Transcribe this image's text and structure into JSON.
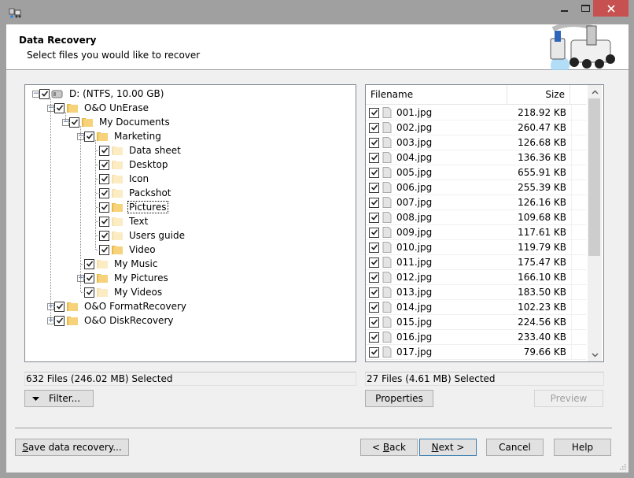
{
  "window": {
    "app_icon": "recovery-robot-icon",
    "controls": {
      "minimize": "minimize-icon",
      "maximize": "maximize-icon",
      "close": "close-icon"
    }
  },
  "header": {
    "title": "Data Recovery",
    "subtitle": "Select files you would like to recover",
    "art": "recovery-robot-illustration"
  },
  "tree": {
    "items": [
      {
        "label": "D: (NTFS, 10.00 GB)",
        "level": 0,
        "expander": "minus",
        "checked": true,
        "icon": "drive-icon"
      },
      {
        "label": "O&O UnErase",
        "level": 1,
        "expander": "minus",
        "checked": true,
        "icon": "folder-icon"
      },
      {
        "label": "My Documents",
        "level": 2,
        "expander": "minus",
        "checked": true,
        "icon": "folder-icon"
      },
      {
        "label": "Marketing",
        "level": 3,
        "expander": "minus",
        "checked": true,
        "icon": "folder-icon"
      },
      {
        "label": "Data sheet",
        "level": 4,
        "expander": "none",
        "checked": true,
        "icon": "folder-empty-icon"
      },
      {
        "label": "Desktop",
        "level": 4,
        "expander": "none",
        "checked": true,
        "icon": "folder-empty-icon"
      },
      {
        "label": "Icon",
        "level": 4,
        "expander": "none",
        "checked": true,
        "icon": "folder-empty-icon"
      },
      {
        "label": "Packshot",
        "level": 4,
        "expander": "none",
        "checked": true,
        "icon": "folder-empty-icon"
      },
      {
        "label": "Pictures",
        "level": 4,
        "expander": "none",
        "checked": true,
        "icon": "folder-icon",
        "focused": true
      },
      {
        "label": "Text",
        "level": 4,
        "expander": "none",
        "checked": true,
        "icon": "folder-empty-icon"
      },
      {
        "label": "Users guide",
        "level": 4,
        "expander": "none",
        "checked": true,
        "icon": "folder-empty-icon"
      },
      {
        "label": "Video",
        "level": 4,
        "expander": "none",
        "checked": true,
        "icon": "folder-icon"
      },
      {
        "label": "My Music",
        "level": 3,
        "expander": "none",
        "checked": true,
        "icon": "folder-empty-icon"
      },
      {
        "label": "My Pictures",
        "level": 3,
        "expander": "plus",
        "checked": true,
        "icon": "folder-icon"
      },
      {
        "label": "My Videos",
        "level": 3,
        "expander": "none",
        "checked": true,
        "icon": "folder-empty-icon"
      },
      {
        "label": "O&O FormatRecovery",
        "level": 1,
        "expander": "plus",
        "checked": true,
        "icon": "folder-icon"
      },
      {
        "label": "O&O DiskRecovery",
        "level": 1,
        "expander": "plus",
        "checked": true,
        "icon": "folder-icon"
      }
    ]
  },
  "file_list": {
    "columns": {
      "filename": "Filename",
      "size": "Size"
    },
    "rows": [
      {
        "name": "001.jpg",
        "size": "218.92 KB",
        "checked": true
      },
      {
        "name": "002.jpg",
        "size": "260.47 KB",
        "checked": true
      },
      {
        "name": "003.jpg",
        "size": "126.68 KB",
        "checked": true
      },
      {
        "name": "004.jpg",
        "size": "136.36 KB",
        "checked": true
      },
      {
        "name": "005.jpg",
        "size": "655.91 KB",
        "checked": true
      },
      {
        "name": "006.jpg",
        "size": "255.39 KB",
        "checked": true
      },
      {
        "name": "007.jpg",
        "size": "126.16 KB",
        "checked": true
      },
      {
        "name": "008.jpg",
        "size": "109.68 KB",
        "checked": true
      },
      {
        "name": "009.jpg",
        "size": "117.61 KB",
        "checked": true
      },
      {
        "name": "010.jpg",
        "size": "119.79 KB",
        "checked": true
      },
      {
        "name": "011.jpg",
        "size": "175.47 KB",
        "checked": true
      },
      {
        "name": "012.jpg",
        "size": "166.10 KB",
        "checked": true
      },
      {
        "name": "013.jpg",
        "size": "183.50 KB",
        "checked": true
      },
      {
        "name": "014.jpg",
        "size": "102.23 KB",
        "checked": true
      },
      {
        "name": "015.jpg",
        "size": "224.56 KB",
        "checked": true
      },
      {
        "name": "016.jpg",
        "size": "233.40 KB",
        "checked": true
      },
      {
        "name": "017.jpg",
        "size": "79.66 KB",
        "checked": true
      }
    ]
  },
  "status": {
    "tree_selection": "632 Files (246.02 MB) Selected",
    "list_selection": "27 Files (4.61 MB) Selected"
  },
  "buttons": {
    "filter": "Filter...",
    "properties": "Properties",
    "preview": "Preview",
    "save_recovery": {
      "mnemonic": "S",
      "rest": "ave data recovery..."
    },
    "back": {
      "prefix": "< ",
      "mnemonic": "B",
      "rest": "ack"
    },
    "next": {
      "mnemonic": "N",
      "rest": "ext >"
    },
    "cancel": "Cancel",
    "help": "Help"
  },
  "colors": {
    "close_button": "#c75050",
    "folder": "#f0c85a",
    "folder_empty": "#fbe8b3",
    "default_button_border": "#3c7fb1"
  }
}
